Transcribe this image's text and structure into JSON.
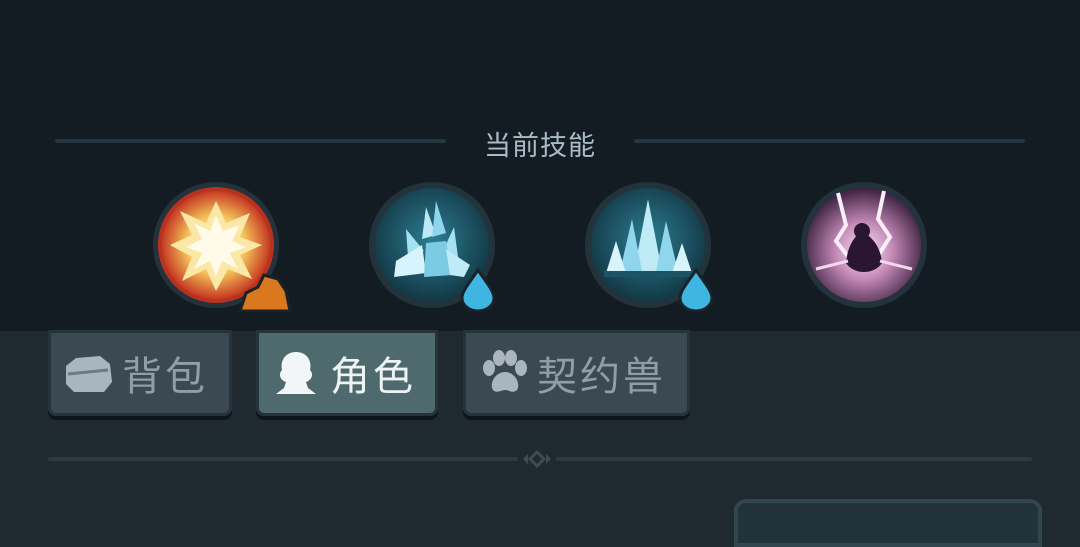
{
  "skills": {
    "section_title": "当前技能",
    "items": [
      {
        "icon": "explosion-skill-icon",
        "badge": "rock-element-badge",
        "accent": "#e1741f"
      },
      {
        "icon": "ice-crystal-skill-icon",
        "badge": "water-element-badge",
        "accent": "#3fb6e2"
      },
      {
        "icon": "ice-spikes-skill-icon",
        "badge": "water-element-badge",
        "accent": "#3fb6e2"
      },
      {
        "icon": "shadow-lightning-skill-icon",
        "badge": "",
        "accent": "#b05a9c"
      }
    ]
  },
  "tabs": [
    {
      "label": "背包",
      "icon": "bag-icon",
      "active": false
    },
    {
      "label": "角色",
      "icon": "character-icon",
      "active": true
    },
    {
      "label": "契约兽",
      "icon": "paw-icon",
      "active": false
    }
  ]
}
